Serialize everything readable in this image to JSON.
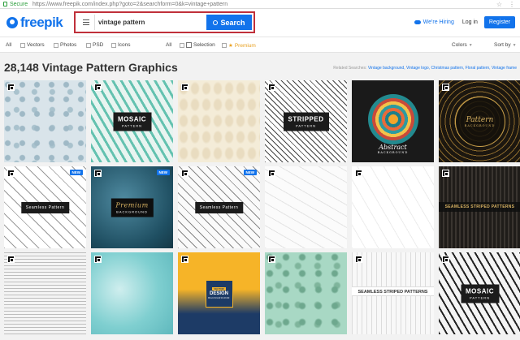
{
  "browser": {
    "secure_label": "Secure",
    "url": "https://www.freepik.com/index.php?goto=2&searchform=0&k=vintage+pattern"
  },
  "header": {
    "logo_text": "freepik",
    "search_value": "vintage pattern",
    "search_button": "Search",
    "hiring": "We're Hiring",
    "login": "Log in",
    "register": "Register"
  },
  "filters": {
    "all_left": "All",
    "vectors": "Vectors",
    "photos": "Photos",
    "psd": "PSD",
    "icons": "Icons",
    "all_right": "All",
    "selection": "Selection",
    "premium": "Premium",
    "colors": "Colors",
    "sort_by": "Sort by"
  },
  "results": {
    "title": "28,148 Vintage Pattern Graphics",
    "related_label": "Related Searches:",
    "related_links": "Vintage background, Vintage logo, Christmas pattern, Floral pattern, Vintage frame"
  },
  "tiles": {
    "t2": {
      "l1": "MOSAIC",
      "l2": "PATTERN"
    },
    "t4": {
      "l1": "STRIPPED",
      "l2": "PATTERN"
    },
    "t5": {
      "l1": "Abstract",
      "l2": "BACKGROUND"
    },
    "t6": {
      "l1": "Pattern",
      "l2": "BACKGROUND"
    },
    "t7": {
      "l1": "Seamless Pattern",
      "l2": ""
    },
    "t8": {
      "l1": "Premium",
      "l2": "BACKGROUND"
    },
    "t9": {
      "l1": "Seamless Pattern",
      "l2": ""
    },
    "t12": {
      "l1": "SEAMLESS STRIPED PATTERNS"
    },
    "t15": {
      "tag": "VECTOR",
      "l1": "DESIGN",
      "l2": "BACKGROUND"
    },
    "t17": {
      "l1": "SEAMLESS STRIPED PATTERNS"
    },
    "t18": {
      "l1": "MOSAIC",
      "l2": "PATTERN"
    },
    "new_badge": "NEW"
  },
  "colors": {
    "brand_blue": "#1273eb",
    "search_highlight": "#c0303a",
    "premium": "#e8a020"
  }
}
